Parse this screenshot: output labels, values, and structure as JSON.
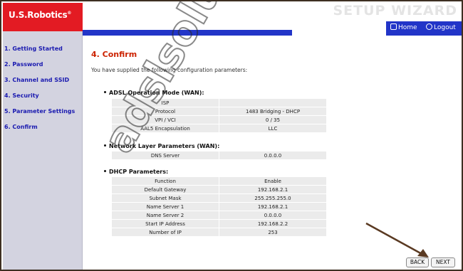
{
  "header": {
    "logo": "U.S.Robotics",
    "wizard_title": "SETUP WIZARD",
    "nav": {
      "home": "Home",
      "logout": "Logout"
    }
  },
  "sidebar": {
    "items": [
      {
        "label": "1. Getting Started"
      },
      {
        "label": "2. Password"
      },
      {
        "label": "3. Channel and SSID"
      },
      {
        "label": "4. Security"
      },
      {
        "label": "5. Parameter Settings"
      },
      {
        "label": "6. Confirm"
      }
    ]
  },
  "main": {
    "title": "4. Confirm",
    "intro": "You have supplied the following configuration parameters:",
    "sections": [
      {
        "heading": "ADSL Operation Mode (WAN):",
        "rows": [
          [
            "ISP",
            ""
          ],
          [
            "Protocol",
            "1483 Bridging - DHCP"
          ],
          [
            "VPI / VCI",
            "0 / 35"
          ],
          [
            "AAL5 Encapsulation",
            "LLC"
          ]
        ]
      },
      {
        "heading": "Network Layer Parameters (WAN):",
        "rows": [
          [
            "DNS Server",
            "0.0.0.0"
          ]
        ]
      },
      {
        "heading": "DHCP Parameters:",
        "rows": [
          [
            "Function",
            "Enable"
          ],
          [
            "Default Gateway",
            "192.168.2.1"
          ],
          [
            "Subnet Mask",
            "255.255.255.0"
          ],
          [
            "Name Server 1",
            "192.168.2.1"
          ],
          [
            "Name Server 2",
            "0.0.0.0"
          ],
          [
            "Start IP Address",
            "192.168.2.2"
          ],
          [
            "Number of IP",
            "253"
          ]
        ]
      }
    ]
  },
  "watermark": "adslsolution",
  "buttons": {
    "back": "BACK",
    "next": "NEXT"
  },
  "colors": {
    "brand_red": "#e31b23",
    "nav_blue": "#2235c8",
    "title_red": "#cc2200",
    "sidebar_bg": "#d3d3e0"
  }
}
